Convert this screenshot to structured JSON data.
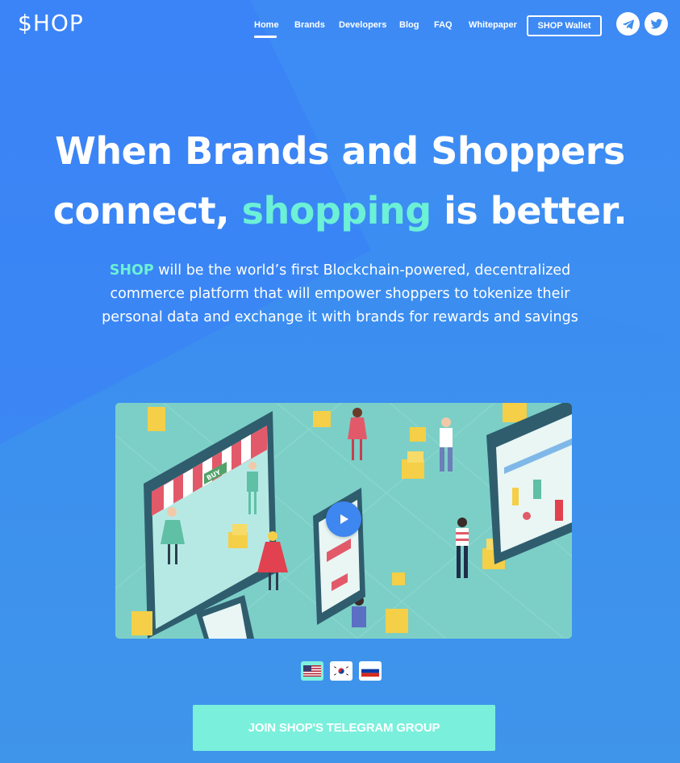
{
  "header": {
    "logo": "$HOP",
    "nav": [
      {
        "label": "Home",
        "active": true
      },
      {
        "label": "Brands"
      },
      {
        "label": "Developers"
      },
      {
        "label": "Blog"
      },
      {
        "label": "FAQ"
      },
      {
        "label": "Whitepaper"
      }
    ],
    "wallet_button": "SHOP Wallet",
    "social": [
      "telegram-icon",
      "twitter-icon"
    ]
  },
  "hero": {
    "headline_line1": "When Brands and Shoppers",
    "headline_line2_start": "connect, ",
    "headline_accent": "shopping",
    "headline_line2_end": " is better.",
    "subtext_accent": "SHOP",
    "subtext_rest": " will be the world’s first Blockchain-powered, decentralized commerce platform that will empower shoppers to tokenize their personal data and exchange it with brands for rewards and savings"
  },
  "video": {
    "poster_sign": "BUY"
  },
  "languages": [
    {
      "code": "us-flag-icon",
      "active": true
    },
    {
      "code": "kr-flag-icon",
      "active": false
    },
    {
      "code": "ru-flag-icon",
      "active": false
    }
  ],
  "cta": {
    "label": "JOIN SHOP'S TELEGRAM GROUP"
  },
  "colors": {
    "background": "#3f8ff0",
    "accent": "#6cf0d6",
    "cta": "#7af0dc"
  }
}
